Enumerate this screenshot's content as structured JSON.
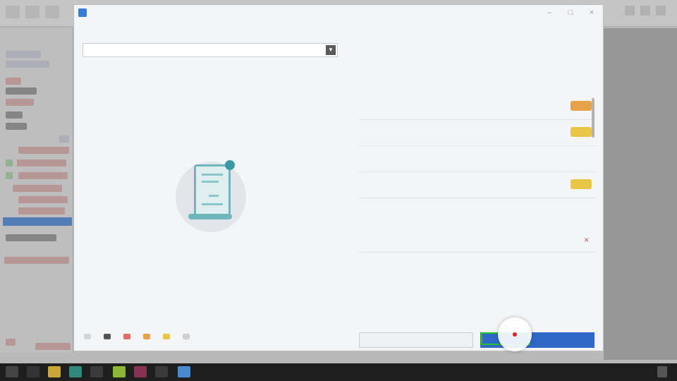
{
  "dialog": {
    "title": "",
    "section_top": "",
    "dropdown_value": "",
    "section_left": "",
    "section_right_top": "",
    "section_right_bottom": "",
    "empty_message_line1": "",
    "empty_message_line2": "",
    "small_link": "",
    "secondary_button": "",
    "primary_button": ""
  },
  "available_items": [
    {
      "title": "",
      "sub": "",
      "tag_color": "#e8a24a"
    },
    {
      "title": "",
      "sub": "",
      "tag_color": "#e9c646"
    },
    {
      "title": "",
      "sub": "",
      "tag_color": ""
    },
    {
      "title": "",
      "sub": "",
      "tag_color": "#e9c646"
    }
  ],
  "selected_items": [
    {
      "title": "",
      "sub": ""
    }
  ],
  "legend": [
    {
      "label": "",
      "color": "#d5d5d5"
    },
    {
      "label": "",
      "color": "#555555"
    },
    {
      "label": "",
      "color": "#e06b6b"
    },
    {
      "label": "",
      "color": "#e8a24a"
    },
    {
      "label": "",
      "color": "#e9c646"
    },
    {
      "label": "",
      "color": "#cfcfcf"
    }
  ],
  "colors": {
    "accent": "#2f68c7",
    "target_highlight": "#22c322",
    "cursor": "#e02020"
  }
}
